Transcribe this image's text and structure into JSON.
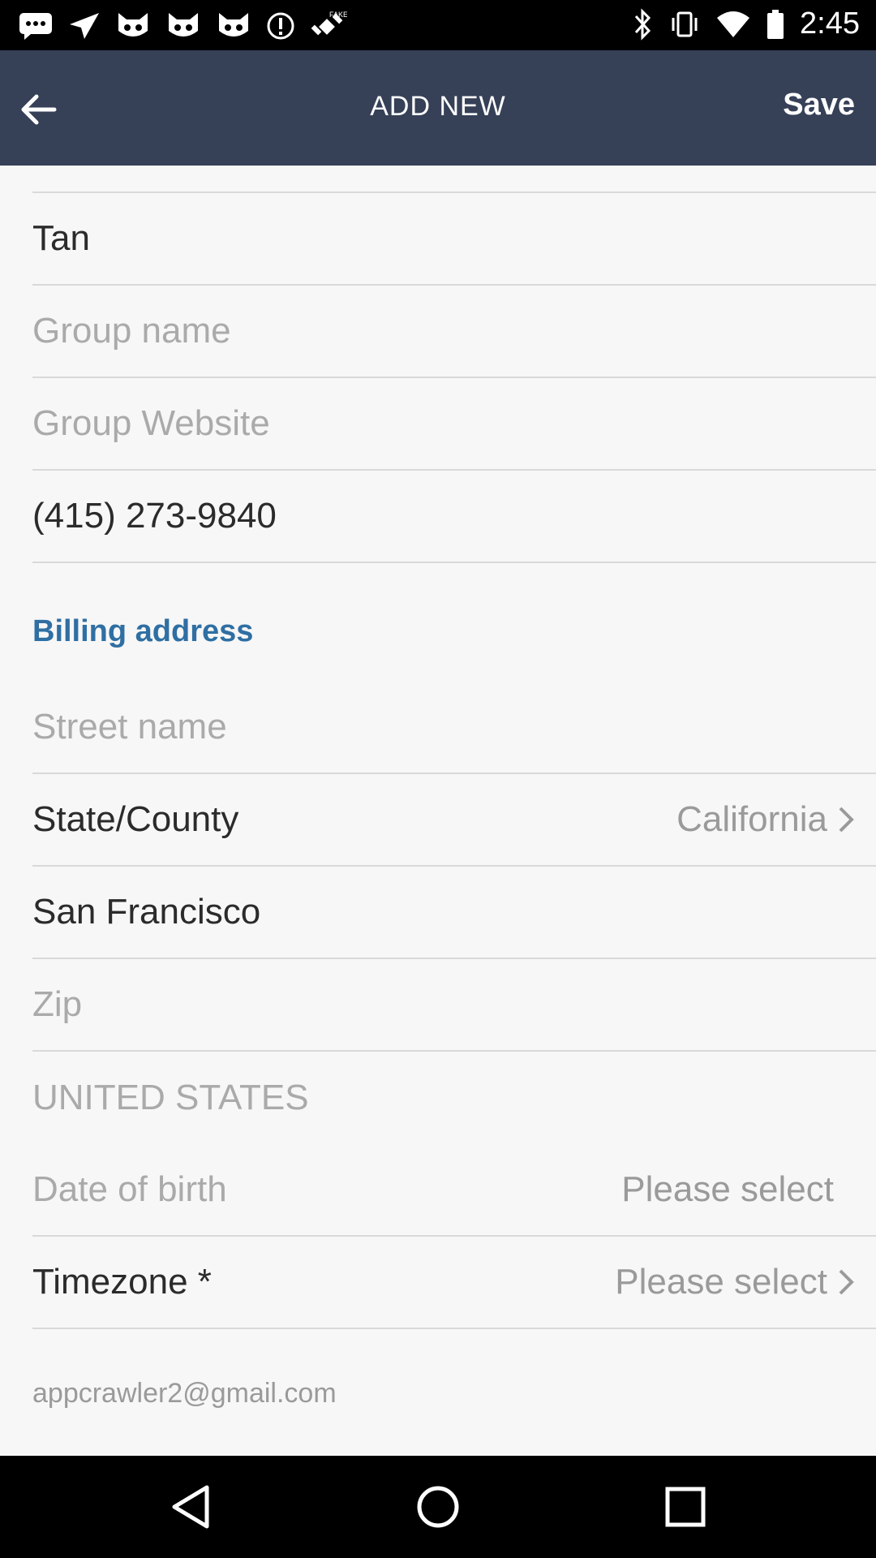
{
  "status_bar": {
    "time": "2:45",
    "icons": [
      "chat-icon",
      "send-icon",
      "cat-face-icon",
      "cat-face-icon",
      "cat-face-icon",
      "alert-circle-icon",
      "fake-gps-icon",
      "bluetooth-icon",
      "vibrate-icon",
      "wifi-icon",
      "battery-icon"
    ],
    "fake_label": "FAKE"
  },
  "app_bar": {
    "title": "ADD NEW",
    "save_label": "Save",
    "background": "#364057"
  },
  "form": {
    "last_name": "Tan",
    "group_name_placeholder": "Group name",
    "group_website_placeholder": "Group Website",
    "phone": "(415) 273-9840",
    "section_billing": "Billing address",
    "street_placeholder": "Street name",
    "state_label": "State/County",
    "state_value": "California",
    "city": "San Francisco",
    "zip_placeholder": "Zip",
    "country": "UNITED STATES",
    "dob_label": "Date of birth",
    "dob_value": "Please select",
    "timezone_label": "Timezone *",
    "timezone_value": "Please select",
    "email": "appcrawler2@gmail.com"
  },
  "colors": {
    "accent": "#2f6fa3",
    "placeholder": "#aaaaaa"
  }
}
